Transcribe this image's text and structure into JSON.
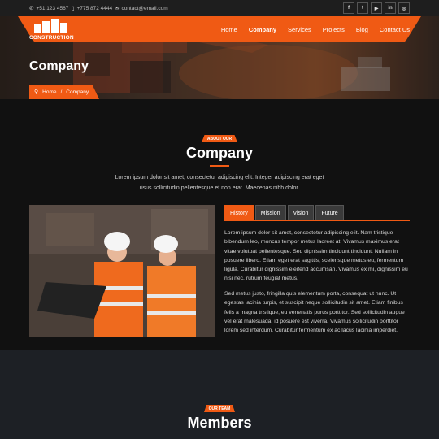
{
  "topbar": {
    "phone1": "+51 123 4567",
    "phone2": "+775 872 4444",
    "email": "contact@email.com",
    "socials": [
      "facebook-icon",
      "twitter-icon",
      "youtube-icon",
      "linkedin-icon",
      "instagram-icon"
    ],
    "social_glyphs": [
      "f",
      "t",
      "▶",
      "in",
      "◎"
    ]
  },
  "brand": {
    "name": "CONSTRUCTION"
  },
  "nav": {
    "items": [
      {
        "label": "Home",
        "active": false
      },
      {
        "label": "Company",
        "active": true
      },
      {
        "label": "Services",
        "active": false
      },
      {
        "label": "Projects",
        "active": false
      },
      {
        "label": "Blog",
        "active": false
      },
      {
        "label": "Contact Us",
        "active": false
      }
    ]
  },
  "hero": {
    "title": "Company",
    "breadcrumb": {
      "home": "Home",
      "separator": "/",
      "current": "Company"
    }
  },
  "about": {
    "badge": "ABOUT OUR",
    "title": "Company",
    "intro": "Lorem ipsum dolor sit amet, consectetur adipiscing elit. Integer adipiscing erat eget risus sollicitudin pellentesque et non erat. Maecenas nibh dolor.",
    "tabs": [
      {
        "label": "History",
        "active": true
      },
      {
        "label": "Mission",
        "active": false
      },
      {
        "label": "Vision",
        "active": false
      },
      {
        "label": "Future",
        "active": false
      }
    ],
    "paragraph1": "Lorem ipsum dolor sit amet, consectetur adipiscing elit. Nam tristique bibendum leo, rhoncus tempor metus laoreet at. Vivamus maximus erat vitae volutpat pellentesque. Sed dignissim tincidunt tincidunt. Nullam in posuere libero. Etiam eget erat sagittis, scelerisque metus eu, fermentum ligula. Curabitur dignissim eleifend accumsan. Vivamus ex mi, dignissim eu nisi nec, rutrum feugiat metus.",
    "paragraph2": "Sed metus justo, fringilla quis elementum porta, consequat ut nunc. Ut egestas lacinia turpis, et suscipit neque sollicitudin sit amet. Etiam finibus felis a magna tristique, eu venenatis purus porttitor. Sed sollicitudin augue vel erat malesuada, id posuere est viverra. Vivamus sollicitudin porttitor lorem sed interdum. Curabitur fermentum ex ac lacus lacinia imperdiet."
  },
  "members": {
    "badge": "OUR TEAM",
    "title": "Members"
  },
  "colors": {
    "accent": "#f05a14",
    "dark": "#111111",
    "section2": "#1d2025"
  }
}
